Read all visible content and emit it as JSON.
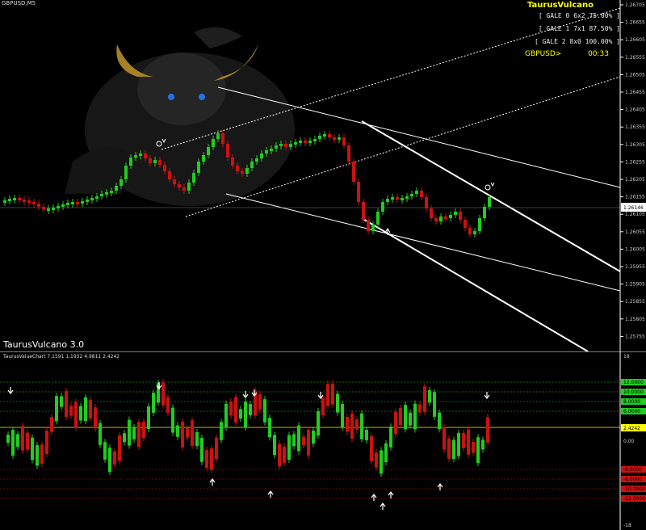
{
  "symbol_label": "GBPUSD,M5",
  "brand": "TaurusVulcano 3.0",
  "panel": {
    "title": "TaurusVulcano",
    "gale_rows": [
      "[  GALE 0  6x2  75.00%  ]",
      "[  GALE 1  7x1  87.50%  ]",
      "[  GALE 2  8x0  100.00%  ]"
    ],
    "pair": "GBPUSD>",
    "timer": "00:33"
  },
  "price_axis": [
    "1.26705",
    "1.26655",
    "1.26605",
    "1.26555",
    "1.26505",
    "1.26455",
    "1.26405",
    "1.26355",
    "1.26305",
    "1.26255",
    "1.26205",
    "1.26155",
    "1.26105",
    "1.26055",
    "1.26005",
    "1.25955",
    "1.25905",
    "1.25855",
    "1.25805",
    "1.25755"
  ],
  "current_price": "1.26146",
  "indicator": {
    "title": "TaurusValueChart 7.1591 1.1932 4.9811 2.4242",
    "axis_top": "18",
    "axis_bottom": "-18",
    "axis_zero": "0.00",
    "current_value": "2.4242",
    "green_levels": [
      "12.0000",
      "10.0000",
      "8.0000",
      "6.0000"
    ],
    "red_levels": [
      "-6.0000",
      "-8.0000",
      "-10.0000",
      "-12.0000"
    ]
  },
  "colors": {
    "bull": "#22cc22",
    "bear": "#cc1111",
    "text_accent": "#ffff00",
    "background": "#000000"
  }
}
